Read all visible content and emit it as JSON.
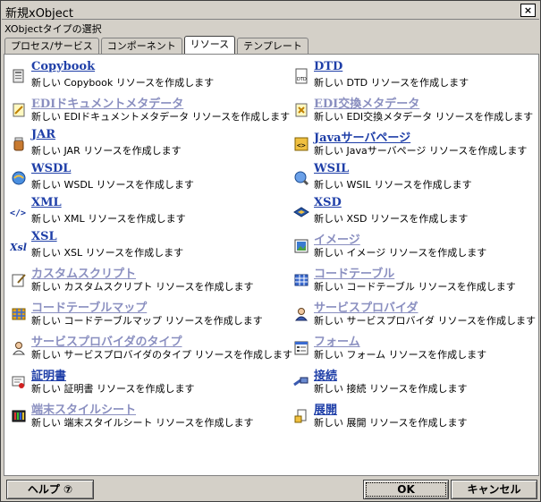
{
  "window": {
    "title": "新規xObject",
    "subtitle": "XObjectタイプの選択",
    "close_label": "×"
  },
  "tabs": [
    {
      "label": "プロセス/サービス"
    },
    {
      "label": "コンポーネント"
    },
    {
      "label": "リソース"
    },
    {
      "label": "テンプレート"
    }
  ],
  "items": [
    {
      "name": "Copybook",
      "desc": "新しい Copybook リソースを作成します",
      "icon": "copybook-icon"
    },
    {
      "name": "DTD",
      "desc": "新しい DTD リソースを作成します",
      "icon": "dtd-icon"
    },
    {
      "name": "EDIドキュメントメタデータ",
      "desc": "新しい EDIドキュメントメタデータ リソースを作成します",
      "icon": "edi-document-icon"
    },
    {
      "name": "EDI交換メタデータ",
      "desc": "新しい EDI交換メタデータ リソースを作成します",
      "icon": "edi-exchange-icon"
    },
    {
      "name": "JAR",
      "desc": "新しい JAR リソースを作成します",
      "icon": "jar-icon"
    },
    {
      "name": "Javaサーバページ",
      "desc": "新しい Javaサーバページ リソースを作成します",
      "icon": "jsp-icon"
    },
    {
      "name": "WSDL",
      "desc": "新しい WSDL リソースを作成します",
      "icon": "wsdl-icon"
    },
    {
      "name": "WSIL",
      "desc": "新しい WSIL リソースを作成します",
      "icon": "wsil-icon"
    },
    {
      "name": "XML",
      "desc": "新しい XML リソースを作成します",
      "icon": "xml-icon"
    },
    {
      "name": "XSD",
      "desc": "新しい XSD リソースを作成します",
      "icon": "xsd-icon"
    },
    {
      "name": "XSL",
      "desc": "新しい XSL リソースを作成します",
      "icon": "xsl-icon"
    },
    {
      "name": "イメージ",
      "desc": "新しい イメージ リソースを作成します",
      "icon": "image-icon"
    },
    {
      "name": "カスタムスクリプト",
      "desc": "新しい カスタムスクリプト リソースを作成します",
      "icon": "custom-script-icon"
    },
    {
      "name": "コードテーブル",
      "desc": "新しい コードテーブル リソースを作成します",
      "icon": "code-table-icon"
    },
    {
      "name": "コードテーブルマップ",
      "desc": "新しい コードテーブルマップ リソースを作成します",
      "icon": "code-table-map-icon"
    },
    {
      "name": "サービスプロバイダ",
      "desc": "新しい サービスプロバイダ リソースを作成します",
      "icon": "service-provider-icon"
    },
    {
      "name": "サービスプロバイダのタイプ",
      "desc": "新しい サービスプロバイダのタイプ リソースを作成します",
      "icon": "service-provider-type-icon"
    },
    {
      "name": "フォーム",
      "desc": "新しい フォーム リソースを作成します",
      "icon": "form-icon"
    },
    {
      "name": "証明書",
      "desc": "新しい 証明書 リソースを作成します",
      "icon": "certificate-icon"
    },
    {
      "name": "接続",
      "desc": "新しい 接続 リソースを作成します",
      "icon": "connection-icon"
    },
    {
      "name": "端末スタイルシート",
      "desc": "新しい 端末スタイルシート リソースを作成します",
      "icon": "terminal-stylesheet-icon"
    },
    {
      "name": "展開",
      "desc": "新しい 展開 リソースを作成します",
      "icon": "deployment-icon"
    }
  ],
  "buttons": {
    "help": "ヘルプ ⑦",
    "ok": "OK",
    "cancel": "キャンセル"
  },
  "colors": {
    "link": "#1f3fa8",
    "link_muted": "#8a8fc0",
    "dialog_bg": "#d4d0c8"
  }
}
